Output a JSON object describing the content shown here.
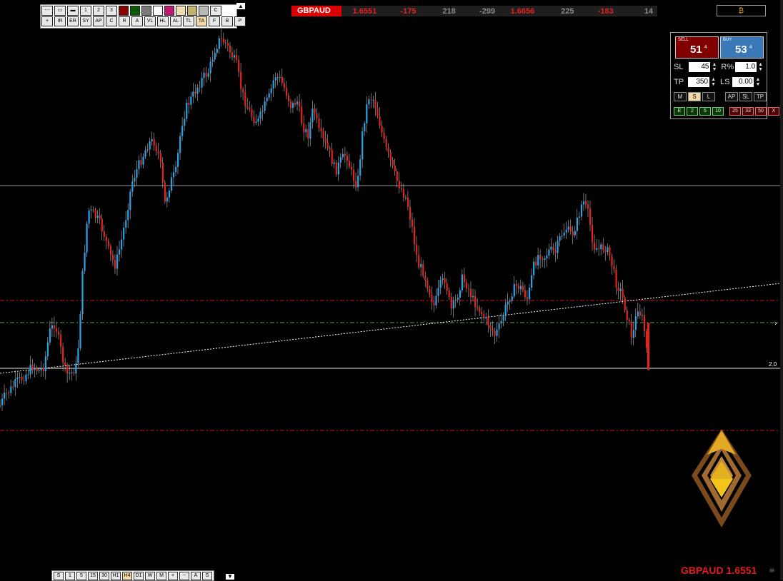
{
  "toolbar": {
    "row1": [
      "⋯",
      "▭",
      "▬",
      "1",
      "2",
      "3",
      "",
      "",
      "",
      "",
      "",
      "",
      "",
      "",
      "C"
    ],
    "row1_colors": [
      "",
      "",
      "",
      "",
      "",
      "",
      "#8b0000",
      "#0a5a0a",
      "#7a7a7a",
      "#ffffff",
      "#c21871",
      "#f2dfb1",
      "#c2b06f",
      "#b8b8b8",
      ""
    ],
    "row2": [
      "+",
      "IR",
      "ER",
      "SY",
      "AP",
      "C",
      "R",
      "A",
      "VL",
      "HL",
      "AL",
      "TL",
      "TA",
      "F",
      "B",
      "P"
    ],
    "active_row2": "TA",
    "collapse_glyph": "▲"
  },
  "ticker": {
    "symbol": "GBPAUD",
    "values": [
      "1.6551",
      "-175",
      "218",
      "-299",
      "1.6656",
      "225",
      "-183",
      "14"
    ],
    "value_colors": [
      "red",
      "red",
      "grey",
      "grey",
      "red",
      "grey",
      "red",
      "grey"
    ],
    "bitcoin_glyph": "₿"
  },
  "trade_panel": {
    "sell_label": "SELL",
    "sell_price": "51",
    "sell_pip": "4",
    "buy_label": "BUY",
    "buy_price": "53",
    "buy_pip": "4",
    "sl_label": "SL",
    "sl_value": "45",
    "rpct_label": "R%",
    "rpct_value": "1.0",
    "tp_label": "TP",
    "tp_value": "350",
    "ls_label": "LS",
    "ls_value": "0.00",
    "mode_buttons": [
      "M",
      "S",
      "L"
    ],
    "mode_selected": "S",
    "right_buttons": [
      "AP",
      "SL",
      "TP"
    ],
    "close_green": [
      "E",
      "2",
      "5",
      "10"
    ],
    "close_red": [
      "25",
      "33",
      "50",
      "X"
    ]
  },
  "timeframes": {
    "items": [
      "S",
      "1",
      "5",
      "15",
      "30",
      "H1",
      "H4",
      "D1",
      "W",
      "M",
      "+",
      "−",
      "A",
      "S"
    ],
    "active": "H4",
    "collapse_glyph": "▼"
  },
  "chart_data": {
    "type": "candlestick",
    "symbol": "GBPAUD",
    "last_price": "1.6551",
    "ratio_label": "2.0",
    "colors": {
      "up": "#29a3e8",
      "down": "#e8221c",
      "wick": "#bbbbbb",
      "grid": "#ffffff",
      "red_level": "#d01515",
      "green_level": "#4bb14b",
      "trendline": "#ffffff"
    },
    "price_path": [
      568,
      553,
      545,
      535,
      530,
      522,
      512,
      520,
      513,
      465,
      452,
      488,
      525,
      522,
      512,
      385,
      294,
      300,
      310,
      330,
      358,
      372,
      340,
      300,
      255,
      235,
      218,
      200,
      198,
      220,
      285,
      255,
      240,
      175,
      148,
      135,
      120,
      108,
      100,
      70,
      55,
      60,
      75,
      90,
      130,
      150,
      165,
      170,
      150,
      135,
      105,
      112,
      128,
      150,
      140,
      175,
      190,
      150,
      185,
      200,
      215,
      240,
      225,
      215,
      245,
      260,
      180,
      135,
      140,
      170,
      205,
      225,
      250,
      265,
      280,
      320,
      370,
      380,
      405,
      430,
      400,
      390,
      435,
      420,
      390,
      400,
      420,
      430,
      445,
      455,
      470,
      455,
      430,
      410,
      400,
      405,
      420,
      375,
      355,
      360,
      350,
      355,
      330,
      320,
      330,
      310,
      280,
      300,
      345,
      350,
      345,
      360,
      395,
      410,
      440,
      475,
      430,
      450,
      515
    ]
  },
  "branding": {
    "bottom_symbol": "GBPAUD 1.6551",
    "skull_glyph": "☠"
  }
}
